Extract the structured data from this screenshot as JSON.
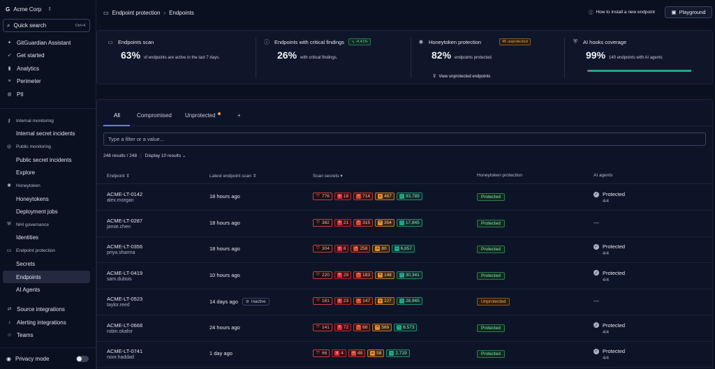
{
  "sidebar": {
    "org": "Acme Corp",
    "quick_search": {
      "label": "Quick search",
      "shortcut": "Ctrl+K"
    },
    "top_items": [
      {
        "label": "GitGuardian Assistant",
        "icon": "sparkle-icon"
      },
      {
        "label": "Get started",
        "icon": "rocket-icon"
      },
      {
        "label": "Analytics",
        "icon": "bar-chart-icon"
      },
      {
        "label": "Perimeter",
        "icon": "list-icon"
      },
      {
        "label": "PII",
        "icon": "fingerprint-icon"
      }
    ],
    "sections": [
      {
        "title": "Internal monitoring",
        "items": [
          "Internal secret incidents"
        ]
      },
      {
        "title": "Public monitoring",
        "items": [
          "Public secret incidents",
          "Explore"
        ]
      },
      {
        "title": "Honeytoken",
        "items": [
          "Honeytokens",
          "Deployment jobs"
        ]
      },
      {
        "title": "NHI governance",
        "items": [
          "Identities"
        ]
      },
      {
        "title": "Endpoint protection",
        "items": [
          "Secrets",
          "Endpoints",
          "AI Agents"
        ]
      }
    ],
    "bottom_items": [
      {
        "label": "Source integrations"
      },
      {
        "label": "Alerting integrations"
      },
      {
        "label": "Teams"
      }
    ],
    "privacy_mode": "Privacy mode"
  },
  "header": {
    "breadcrumb": [
      "Endpoint protection",
      "Endpoints"
    ],
    "howto": "How to install a new endpoint",
    "playground": "Playground"
  },
  "stats": {
    "scan": {
      "title": "Endpoints scan",
      "value": "63%",
      "desc": "of endpoints are active in the last 7 days."
    },
    "critical": {
      "title": "Endpoints with critical findings",
      "delta": "↘ -4.41%",
      "value": "26%",
      "desc": "with critical findings."
    },
    "honeytoken": {
      "title": "Honeytoken protection",
      "badge": "45 unprotected",
      "value": "82%",
      "desc": "endpoints protected.",
      "link": "View unprotected endpoints"
    },
    "ai": {
      "title": "AI hooks coverage",
      "value": "99%",
      "desc": "140 endpoints with AI agents",
      "coverage": 0.99
    }
  },
  "tabs": {
    "all": "All",
    "compromised": "Compromised",
    "unprotected": "Unprotected",
    "add": "+"
  },
  "filter_placeholder": "Type a filter or a value...",
  "results": {
    "count": "248 results / 248",
    "display": "Display 10 results"
  },
  "columns": {
    "endpoint": "Endpoint",
    "latest_scan": "Latest endpoint scan",
    "secrets": "Scan secrets",
    "honeytoken": "Honeytoken protection",
    "ai": "AI agents"
  },
  "rows": [
    {
      "name": "ACME-LT-0142",
      "user": "alex.morgan",
      "scan": "18 hours ago",
      "inactive": "",
      "total": "776",
      "critical": "18",
      "high": "714",
      "medium": "467",
      "low": "93,789",
      "honey": "Protected",
      "ai_status": "Protected",
      "ai_count": "4/4"
    },
    {
      "name": "ACME-LT-0287",
      "user": "jamie.chen",
      "scan": "18 hours ago",
      "inactive": "",
      "total": "382",
      "critical": "21",
      "high": "315",
      "medium": "354",
      "low": "17,845",
      "honey": "Protected",
      "ai_status": "",
      "ai_count": "—"
    },
    {
      "name": "ACME-LT-0356",
      "user": "priya.sharma",
      "scan": "18 hours ago",
      "inactive": "",
      "total": "304",
      "critical": "8",
      "high": "258",
      "medium": "80",
      "low": "6,857",
      "honey": "Protected",
      "ai_status": "Protected",
      "ai_count": "4/4"
    },
    {
      "name": "ACME-LT-0419",
      "user": "sam.dubois",
      "scan": "10 hours ago",
      "inactive": "",
      "total": "220",
      "critical": "29",
      "high": "183",
      "medium": "148",
      "low": "30,341",
      "honey": "Protected",
      "ai_status": "Protected",
      "ai_count": "4/4"
    },
    {
      "name": "ACME-LT-0523",
      "user": "taylor.reed",
      "scan": "14 days ago",
      "inactive": "Inactive",
      "total": "181",
      "critical": "23",
      "high": "147",
      "medium": "227",
      "low": "28,965",
      "honey": "Unprotected",
      "ai_status": "",
      "ai_count": "—"
    },
    {
      "name": "ACME-LT-0668",
      "user": "robin.okafor",
      "scan": "24 hours ago",
      "inactive": "",
      "total": "141",
      "critical": "72",
      "high": "68",
      "medium": "569",
      "low": "6,573",
      "honey": "Protected",
      "ai_status": "Protected",
      "ai_count": "4/4"
    },
    {
      "name": "ACME-LT-0741",
      "user": "noor.haddad",
      "scan": "1 day ago",
      "inactive": "",
      "total": "66",
      "critical": "4",
      "high": "48",
      "medium": "58",
      "low": "2,719",
      "honey": "Protected",
      "ai_status": "Protected",
      "ai_count": "4/4"
    }
  ]
}
